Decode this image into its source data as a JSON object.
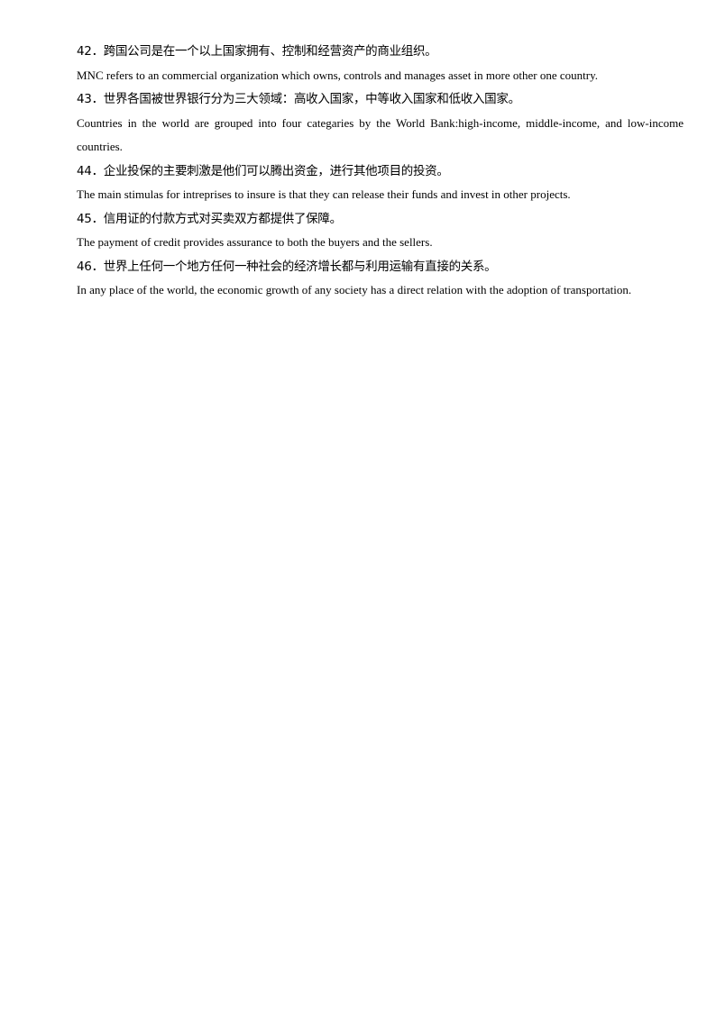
{
  "items": [
    {
      "number": "42．",
      "chinese": "跨国公司是在一个以上国家拥有、控制和经营资产的商业组织。",
      "english": "MNC refers to an commercial organization which owns, controls and manages asset in more other one country."
    },
    {
      "number": "43．",
      "chinese": "世界各国被世界银行分为三大领域：高收入国家，中等收入国家和低收入国家。",
      "english": "Countries in the world are grouped into four categaries by the World Bank:high-income, middle-income, and low-income countries."
    },
    {
      "number": "44．",
      "chinese": "企业投保的主要刺激是他们可以腾出资金，进行其他项目的投资。",
      "english": "The main stimulas for intreprises to insure is that they can release their funds and invest in other projects."
    },
    {
      "number": "45．",
      "chinese": "信用证的付款方式对买卖双方都提供了保障。",
      "english": "The payment of credit provides assurance to both the buyers and the sellers."
    },
    {
      "number": "46．",
      "chinese": "世界上任何一个地方任何一种社会的经济增长都与利用运输有直接的关系。",
      "english": "In any place of the world, the economic growth of any society has a direct relation with the adoption of transportation."
    }
  ]
}
